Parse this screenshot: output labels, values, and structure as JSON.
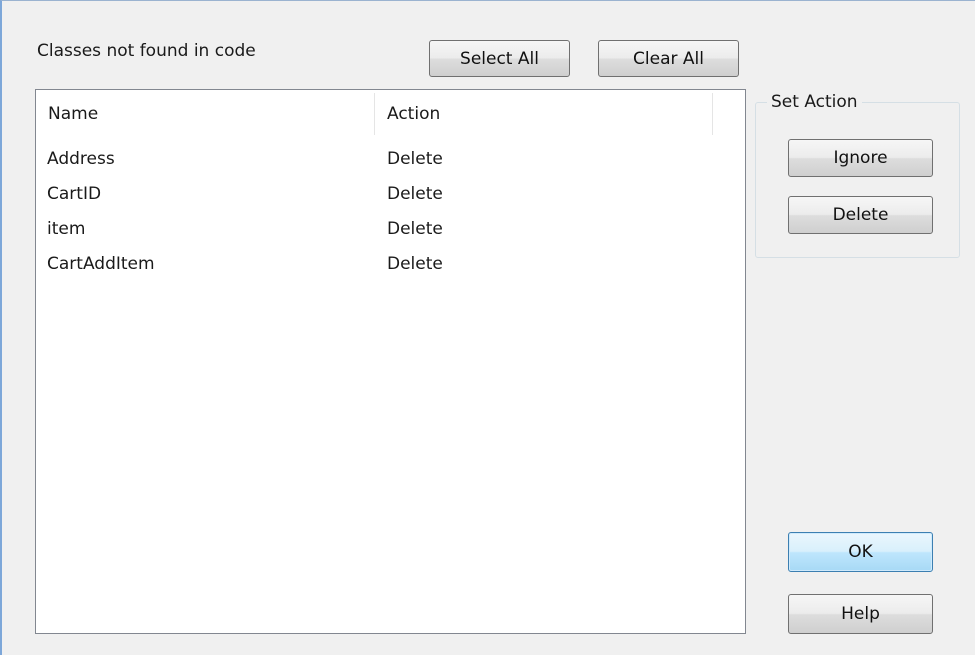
{
  "dialog": {
    "heading": "Classes not found in code",
    "select_all_label": "Select All",
    "clear_all_label": "Clear All"
  },
  "list": {
    "columns": [
      "Name",
      "Action"
    ],
    "rows": [
      {
        "name": "Address",
        "action": "Delete"
      },
      {
        "name": "CartID",
        "action": "Delete"
      },
      {
        "name": "item",
        "action": "Delete"
      },
      {
        "name": "CartAddItem",
        "action": "Delete"
      }
    ]
  },
  "set_action": {
    "title": "Set Action",
    "ignore_label": "Ignore",
    "delete_label": "Delete"
  },
  "footer": {
    "ok_label": "OK",
    "help_label": "Help"
  },
  "colors": {
    "window_bg": "#f0f0f0",
    "list_bg": "#ffffff",
    "default_button_border": "#3c7fb1",
    "list_border": "#828790"
  }
}
